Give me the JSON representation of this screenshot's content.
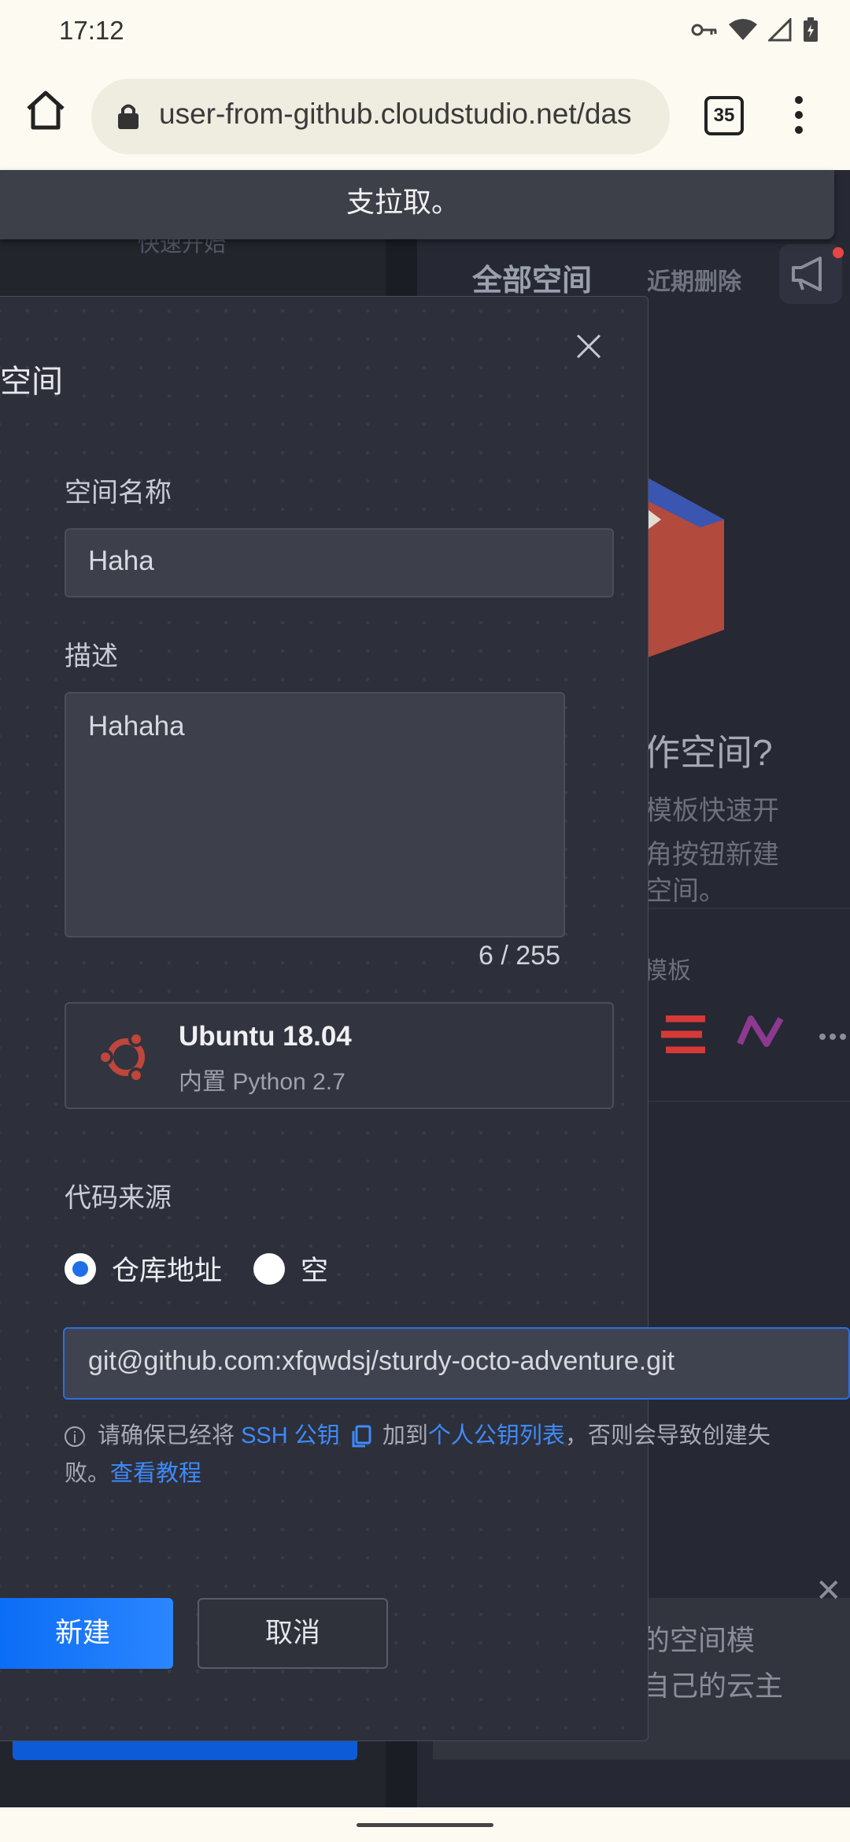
{
  "status_bar": {
    "time": "17:12"
  },
  "browser": {
    "url": "user-from-github.cloudstudio.net/das",
    "tab_count": "35"
  },
  "toast": {
    "text": "支拉取。"
  },
  "background": {
    "faded_text": "快速开始",
    "tab_all": "全部空间",
    "tab_deleted": "近期删除",
    "heading": "作空间?",
    "desc_lines": [
      "模板快速开",
      "角按钮新建",
      "空间。"
    ],
    "templates_label": "模板",
    "card_lines": [
      "的空间模",
      "自己的云主"
    ]
  },
  "dialog": {
    "title": "空间",
    "name_label": "空间名称",
    "name_value": "Haha",
    "desc_label": "描述",
    "desc_value": "Hahaha",
    "counter": "6 / 255",
    "image": {
      "name": "Ubuntu 18.04",
      "sub": "内置 Python 2.7"
    },
    "source_label": "代码来源",
    "radio_repo": "仓库地址",
    "radio_empty": "空",
    "git_url": "git@github.com:xfqwdsj/sturdy-octo-adventure.git",
    "note": {
      "prefix": "请确保已经将",
      "ssh_link": "SSH 公钥",
      "middle": "加到",
      "list_link": "个人公钥列表",
      "suffix": "，否则会导致创建失败。",
      "tutorial_link": "查看教程"
    },
    "create_button": "新建",
    "cancel_button": "取消"
  }
}
